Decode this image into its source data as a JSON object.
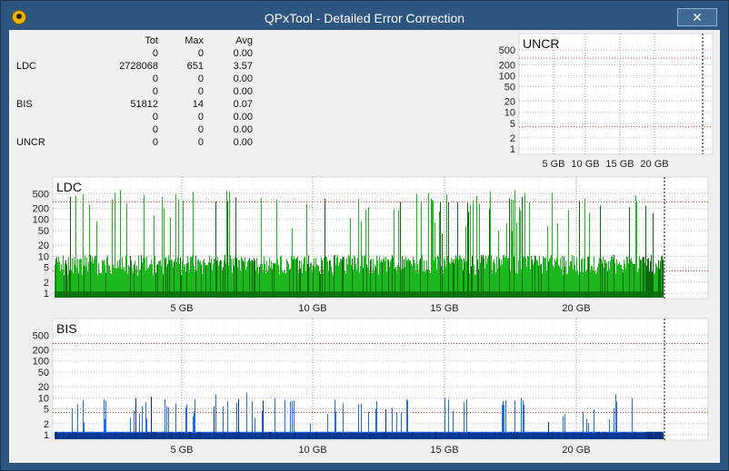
{
  "window": {
    "title": "QPxTool - Detailed Error Correction",
    "close_label": "✕"
  },
  "stats": {
    "headers": {
      "label": "",
      "tot": "Tot",
      "max": "Max",
      "avg": "Avg"
    },
    "rows": [
      {
        "label": "",
        "tot": "0",
        "max": "0",
        "avg": "0.00"
      },
      {
        "label": "LDC",
        "tot": "2728068",
        "max": "651",
        "avg": "3.57"
      },
      {
        "label": "",
        "tot": "0",
        "max": "0",
        "avg": "0.00"
      },
      {
        "label": "",
        "tot": "0",
        "max": "0",
        "avg": "0.00"
      },
      {
        "label": "BIS",
        "tot": "51812",
        "max": "14",
        "avg": "0.07"
      },
      {
        "label": "",
        "tot": "0",
        "max": "0",
        "avg": "0.00"
      },
      {
        "label": "",
        "tot": "0",
        "max": "0",
        "avg": "0.00"
      },
      {
        "label": "UNCR",
        "tot": "0",
        "max": "0",
        "avg": "0.00"
      }
    ]
  },
  "chart_data": [
    {
      "type": "bar",
      "title": "UNCR",
      "x_ticks": [
        "5 GB",
        "10 GB",
        "15 GB",
        "20 GB"
      ],
      "y_ticks": [
        "500",
        "200",
        "100",
        "50",
        "20",
        "10",
        "5",
        "2",
        "1"
      ],
      "y_scale": "log",
      "ylim": [
        1,
        500
      ],
      "values": [
        0
      ],
      "color": "#000000"
    },
    {
      "type": "bar",
      "title": "LDC",
      "x_ticks": [
        "5 GB",
        "10 GB",
        "15 GB",
        "20 GB"
      ],
      "y_ticks": [
        "500",
        "200",
        "100",
        "50",
        "20",
        "10",
        "5",
        "2",
        "1"
      ],
      "y_scale": "log",
      "ylim": [
        1,
        500
      ],
      "max": 651,
      "color": "#1db81d",
      "dark_color": "#0b6b0b"
    },
    {
      "type": "bar",
      "title": "BIS",
      "x_ticks": [
        "5 GB",
        "10 GB",
        "15 GB",
        "20 GB"
      ],
      "y_ticks": [
        "500",
        "200",
        "100",
        "50",
        "20",
        "10",
        "5",
        "2",
        "1"
      ],
      "y_scale": "log",
      "ylim": [
        1,
        500
      ],
      "max": 14,
      "color": "#1e6cf0",
      "dark_color": "#0b2f80"
    }
  ]
}
